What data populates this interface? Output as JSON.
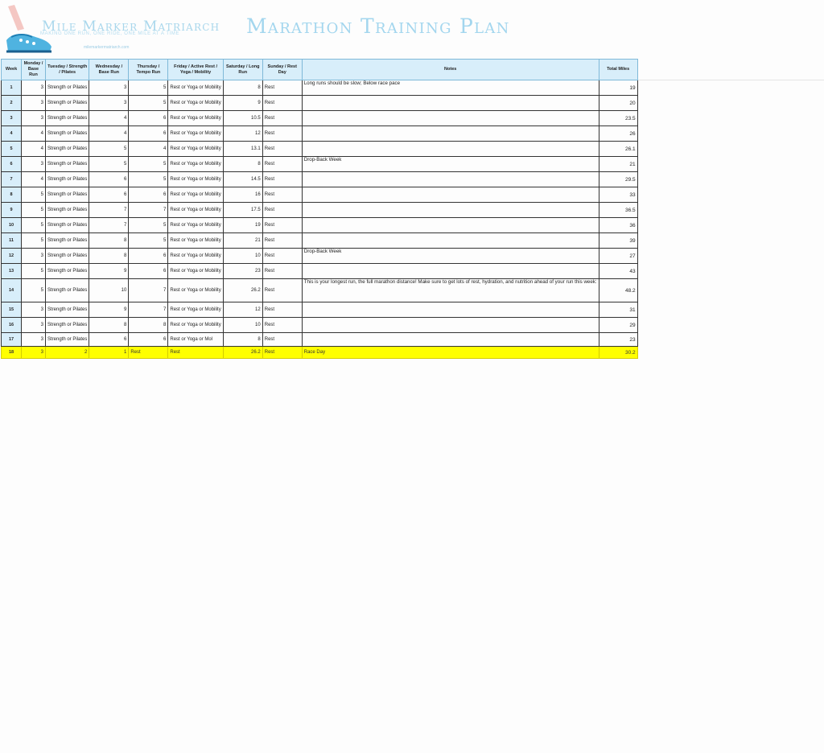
{
  "brand": {
    "name": "Mile Marker Matriarch",
    "tagline": "MAKING ONE RUN, ONE RIDE, ONE MILE AT A TIME",
    "site": "milemarkermatriarch.com"
  },
  "title": "Marathon Training Plan",
  "columns": [
    "Week",
    "Monday / Base Run",
    "Tuesday / Strength / Pilates",
    "Wednesday / Base Run",
    "Thursday / Tempo Run",
    "Friday / Active Rest / Yoga / Mobility",
    "Saturday / Long Run",
    "Sunday / Rest Day",
    "Notes",
    "Total Miles"
  ],
  "rows": [
    {
      "week": "1",
      "mon": "3",
      "tue": "Strength or Pilates",
      "wed": "3",
      "thu": "5",
      "fri": "Rest or Yoga or Mobility",
      "sat": "8",
      "sun": "Rest",
      "notes": "Long runs should be slow; Below race pace",
      "total": "19"
    },
    {
      "week": "2",
      "mon": "3",
      "tue": "Strength or Pilates",
      "wed": "3",
      "thu": "5",
      "fri": "Rest or Yoga or Mobility",
      "sat": "9",
      "sun": "Rest",
      "notes": "",
      "total": "20"
    },
    {
      "week": "3",
      "mon": "3",
      "tue": "Strength or Pilates",
      "wed": "4",
      "thu": "6",
      "fri": "Rest or Yoga or Mobility",
      "sat": "10.5",
      "sun": "Rest",
      "notes": "",
      "total": "23.5"
    },
    {
      "week": "4",
      "mon": "4",
      "tue": "Strength or Pilates",
      "wed": "4",
      "thu": "6",
      "fri": "Rest or Yoga or Mobility",
      "sat": "12",
      "sun": "Rest",
      "notes": "",
      "total": "26"
    },
    {
      "week": "5",
      "mon": "4",
      "tue": "Strength or Pilates",
      "wed": "5",
      "thu": "4",
      "fri": "Rest or Yoga or Mobility",
      "sat": "13.1",
      "sun": "Rest",
      "notes": "",
      "total": "26.1"
    },
    {
      "week": "6",
      "mon": "3",
      "tue": "Strength or Pilates",
      "wed": "5",
      "thu": "5",
      "fri": "Rest or Yoga or Mobility",
      "sat": "8",
      "sun": "Rest",
      "notes": "Drop-Back Week",
      "total": "21"
    },
    {
      "week": "7",
      "mon": "4",
      "tue": "Strength or Pilates",
      "wed": "6",
      "thu": "5",
      "fri": "Rest or Yoga or Mobility",
      "sat": "14.5",
      "sun": "Rest",
      "notes": "",
      "total": "29.5"
    },
    {
      "week": "8",
      "mon": "5",
      "tue": "Strength or Pilates",
      "wed": "6",
      "thu": "6",
      "fri": "Rest or Yoga or Mobility",
      "sat": "16",
      "sun": "Rest",
      "notes": "",
      "total": "33"
    },
    {
      "week": "9",
      "mon": "5",
      "tue": "Strength or Pilates",
      "wed": "7",
      "thu": "7",
      "fri": "Rest or Yoga or Mobility",
      "sat": "17.5",
      "sun": "Rest",
      "notes": "",
      "total": "36.5"
    },
    {
      "week": "10",
      "mon": "5",
      "tue": "Strength or Pilates",
      "wed": "7",
      "thu": "5",
      "fri": "Rest or Yoga or Mobility",
      "sat": "19",
      "sun": "Rest",
      "notes": "",
      "total": "36"
    },
    {
      "week": "11",
      "mon": "5",
      "tue": "Strength or Pilates",
      "wed": "8",
      "thu": "5",
      "fri": "Rest or Yoga or Mobility",
      "sat": "21",
      "sun": "Rest",
      "notes": "",
      "total": "39"
    },
    {
      "week": "12",
      "mon": "3",
      "tue": "Strength or Pilates",
      "wed": "8",
      "thu": "6",
      "fri": "Rest or Yoga or Mobility",
      "sat": "10",
      "sun": "Rest",
      "notes": "Drop-Back Week",
      "total": "27"
    },
    {
      "week": "13",
      "mon": "5",
      "tue": "Strength or Pilates",
      "wed": "9",
      "thu": "6",
      "fri": "Rest or Yoga or Mobility",
      "sat": "23",
      "sun": "Rest",
      "notes": "",
      "total": "43"
    },
    {
      "week": "14",
      "mon": "5",
      "tue": "Strength or Pilates",
      "wed": "10",
      "thu": "7",
      "fri": "Rest or Yoga or Mobility",
      "sat": "26.2",
      "sun": "Rest",
      "notes": "This is your longest run, the full marathon distance! Make sure to get lots of rest, hydration, and nutrition ahead of your run this week:",
      "total": "48.2"
    },
    {
      "week": "15",
      "mon": "3",
      "tue": "Strength or Pilates",
      "wed": "9",
      "thu": "7",
      "fri": "Rest or Yoga or Mobility",
      "sat": "12",
      "sun": "Rest",
      "notes": "",
      "total": "31"
    },
    {
      "week": "16",
      "mon": "3",
      "tue": "Strength or Pilates",
      "wed": "8",
      "thu": "8",
      "fri": "Rest or Yoga or Mobility",
      "sat": "10",
      "sun": "Rest",
      "notes": "",
      "total": "29"
    },
    {
      "week": "17",
      "mon": "3",
      "tue": "Strength or Pilates",
      "wed": "6",
      "thu": "6",
      "fri": "Rest or Yoga or Mol",
      "sat": "8",
      "sun": "Rest",
      "notes": "",
      "total": "23"
    },
    {
      "week": "18",
      "mon": "3",
      "tue": "2",
      "wed": "1",
      "thu": "Rest",
      "fri": "Rest",
      "sat": "26.2",
      "sun": "Rest",
      "notes": "Race Day",
      "total": "30.2"
    }
  ]
}
